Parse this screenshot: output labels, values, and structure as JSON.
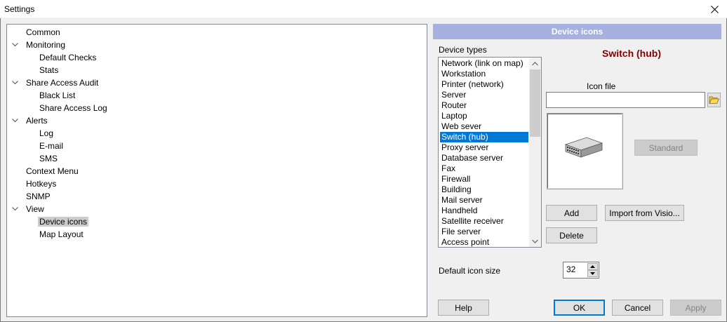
{
  "window": {
    "title": "Settings"
  },
  "tree": {
    "items": [
      {
        "label": "Common",
        "level": 0,
        "expandable": false,
        "selected": false
      },
      {
        "label": "Monitoring",
        "level": 0,
        "expandable": true,
        "selected": false
      },
      {
        "label": "Default Checks",
        "level": 1,
        "expandable": false,
        "selected": false
      },
      {
        "label": "Stats",
        "level": 1,
        "expandable": false,
        "selected": false
      },
      {
        "label": "Share Access Audit",
        "level": 0,
        "expandable": true,
        "selected": false
      },
      {
        "label": "Black List",
        "level": 1,
        "expandable": false,
        "selected": false
      },
      {
        "label": "Share Access Log",
        "level": 1,
        "expandable": false,
        "selected": false
      },
      {
        "label": "Alerts",
        "level": 0,
        "expandable": true,
        "selected": false
      },
      {
        "label": "Log",
        "level": 1,
        "expandable": false,
        "selected": false
      },
      {
        "label": "E-mail",
        "level": 1,
        "expandable": false,
        "selected": false
      },
      {
        "label": "SMS",
        "level": 1,
        "expandable": false,
        "selected": false
      },
      {
        "label": "Context Menu",
        "level": 0,
        "expandable": false,
        "selected": false
      },
      {
        "label": "Hotkeys",
        "level": 0,
        "expandable": false,
        "selected": false
      },
      {
        "label": "SNMP",
        "level": 0,
        "expandable": false,
        "selected": false
      },
      {
        "label": "View",
        "level": 0,
        "expandable": true,
        "selected": false
      },
      {
        "label": "Device icons",
        "level": 1,
        "expandable": false,
        "selected": true
      },
      {
        "label": "Map Layout",
        "level": 1,
        "expandable": false,
        "selected": false
      }
    ]
  },
  "panel": {
    "header": "Device icons",
    "device_types_label": "Device types",
    "selected_device": "Switch (hub)",
    "device_types": [
      "Network (link on map)",
      "Workstation",
      "Printer (network)",
      "Server",
      "Router",
      "Laptop",
      "Web sever",
      "Switch (hub)",
      "Proxy server",
      "Database server",
      "Fax",
      "Firewall",
      "Building",
      "Mail server",
      "Handheld",
      "Satellite receiver",
      "File server",
      "Access point"
    ],
    "icon_file_label": "Icon file",
    "icon_file_value": "",
    "standard_button": "Standard",
    "add_button": "Add",
    "import_button": "Import from Visio...",
    "delete_button": "Delete",
    "default_icon_size_label": "Default icon size",
    "default_icon_size_value": "32"
  },
  "footer": {
    "help": "Help",
    "ok": "OK",
    "cancel": "Cancel",
    "apply": "Apply"
  },
  "colors": {
    "header_bg": "#a6b1e0",
    "device_title": "#800000",
    "selection": "#0078d7"
  }
}
